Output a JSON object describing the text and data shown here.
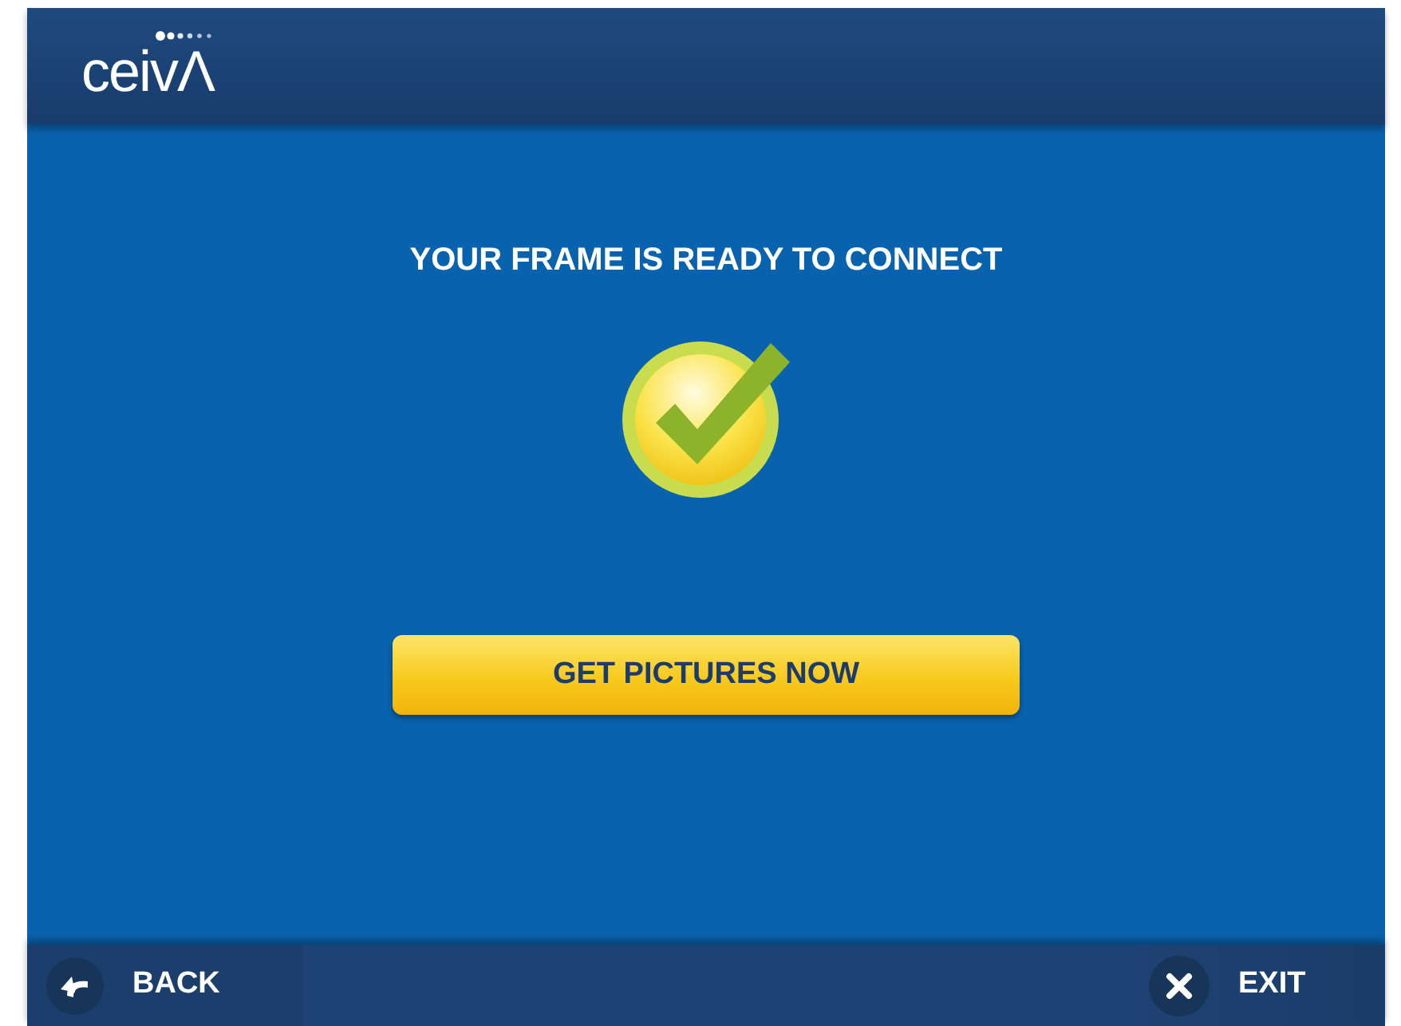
{
  "header": {
    "logo": "ceivΛ"
  },
  "message": {
    "title": "YOUR FRAME IS READY TO CONNECT"
  },
  "action_button": {
    "label": "GET PICTURES NOW"
  },
  "footer": {
    "back": {
      "label": "BACK"
    },
    "exit": {
      "label": "EXIT"
    }
  }
}
